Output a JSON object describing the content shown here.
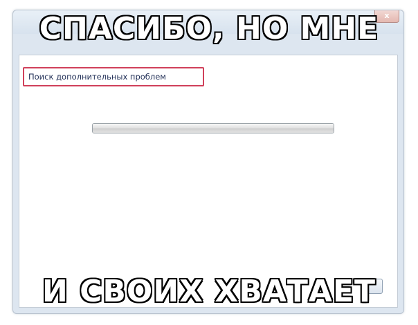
{
  "meme": {
    "top_caption": "СПАСИБО, НО МНЕ",
    "bottom_caption": "И СВОИХ ХВАТАЕТ"
  },
  "window": {
    "close_symbol": "x",
    "status_text": "Поиск дополнительных проблем",
    "progress_fraction": 1.0,
    "accent_color": "#d0405a"
  }
}
